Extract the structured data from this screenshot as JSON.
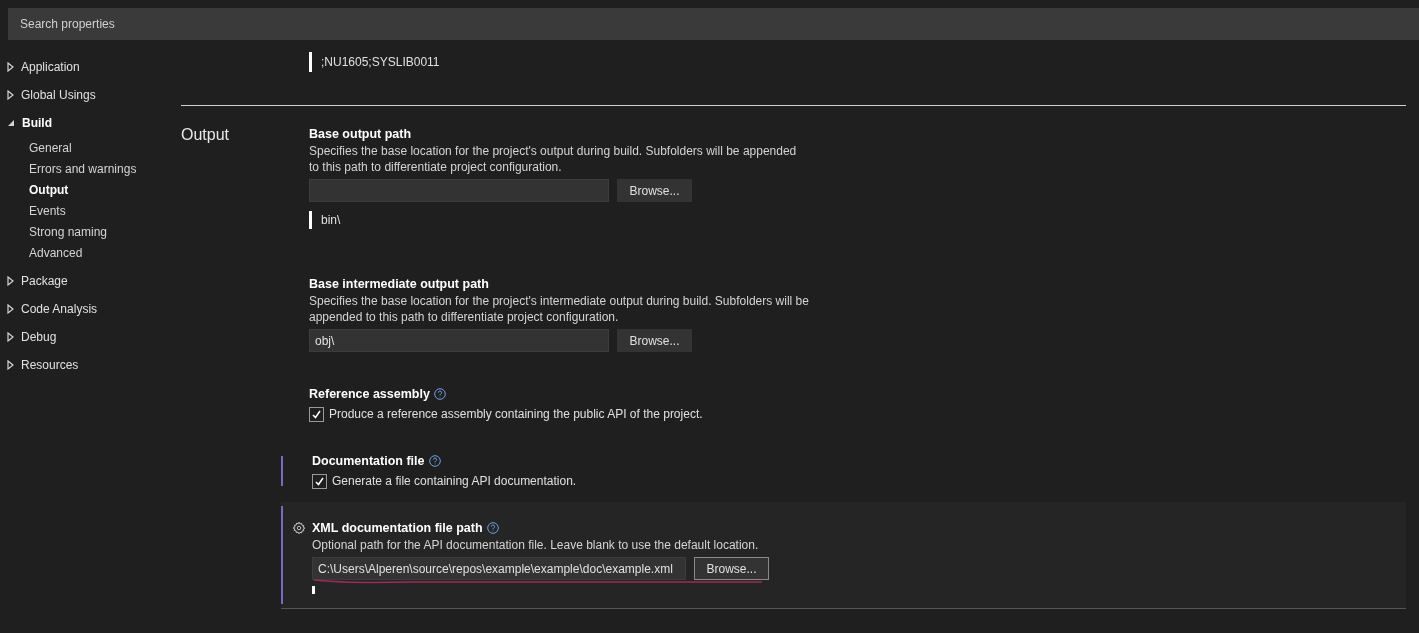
{
  "search": {
    "placeholder": "Search properties"
  },
  "sidebar": {
    "items": [
      {
        "label": "Application",
        "expanded": false
      },
      {
        "label": "Global Usings",
        "expanded": false
      },
      {
        "label": "Build",
        "expanded": true,
        "children": [
          {
            "label": "General",
            "selected": false
          },
          {
            "label": "Errors and warnings",
            "selected": false
          },
          {
            "label": "Output",
            "selected": true
          },
          {
            "label": "Events",
            "selected": false
          },
          {
            "label": "Strong naming",
            "selected": false
          },
          {
            "label": "Advanced",
            "selected": false
          }
        ]
      },
      {
        "label": "Package",
        "expanded": false
      },
      {
        "label": "Code Analysis",
        "expanded": false
      },
      {
        "label": "Debug",
        "expanded": false
      },
      {
        "label": "Resources",
        "expanded": false
      }
    ]
  },
  "previous_value": ";NU1605;SYSLIB0011",
  "section": {
    "title": "Output",
    "properties": [
      {
        "kind": "path",
        "title": "Base output path",
        "help": false,
        "modified": false,
        "focused": false,
        "description": "Specifies the base location for the project's output during build. Subfolders will be appended to this path to differentiate project configuration.",
        "button": "Browse...",
        "evaluated": "bin\\"
      },
      {
        "kind": "path",
        "title": "Base intermediate output path",
        "help": false,
        "modified": false,
        "focused": false,
        "description": "Specifies the base location for the project's intermediate output during build. Subfolders will be appended to this path to differentiate project configuration.",
        "value": "obj\\",
        "button": "Browse..."
      },
      {
        "kind": "checkbox",
        "title": "Reference assembly",
        "help": true,
        "modified": false,
        "focused": false,
        "checkbox": {
          "label": "Produce a reference assembly containing the public API of the project.",
          "checked": true
        }
      },
      {
        "kind": "checkbox",
        "title": "Documentation file",
        "help": true,
        "modified": true,
        "focused": false,
        "checkbox": {
          "label": "Generate a file containing API documentation.",
          "checked": true
        }
      },
      {
        "kind": "path",
        "title": "XML documentation file path",
        "help": true,
        "modified": true,
        "focused": true,
        "description": "Optional path for the API documentation file. Leave blank to use the default location.",
        "value": "C:\\Users\\Alperen\\source\\repos\\example\\example\\doc\\example.xml",
        "button": "Browse..."
      }
    ]
  }
}
